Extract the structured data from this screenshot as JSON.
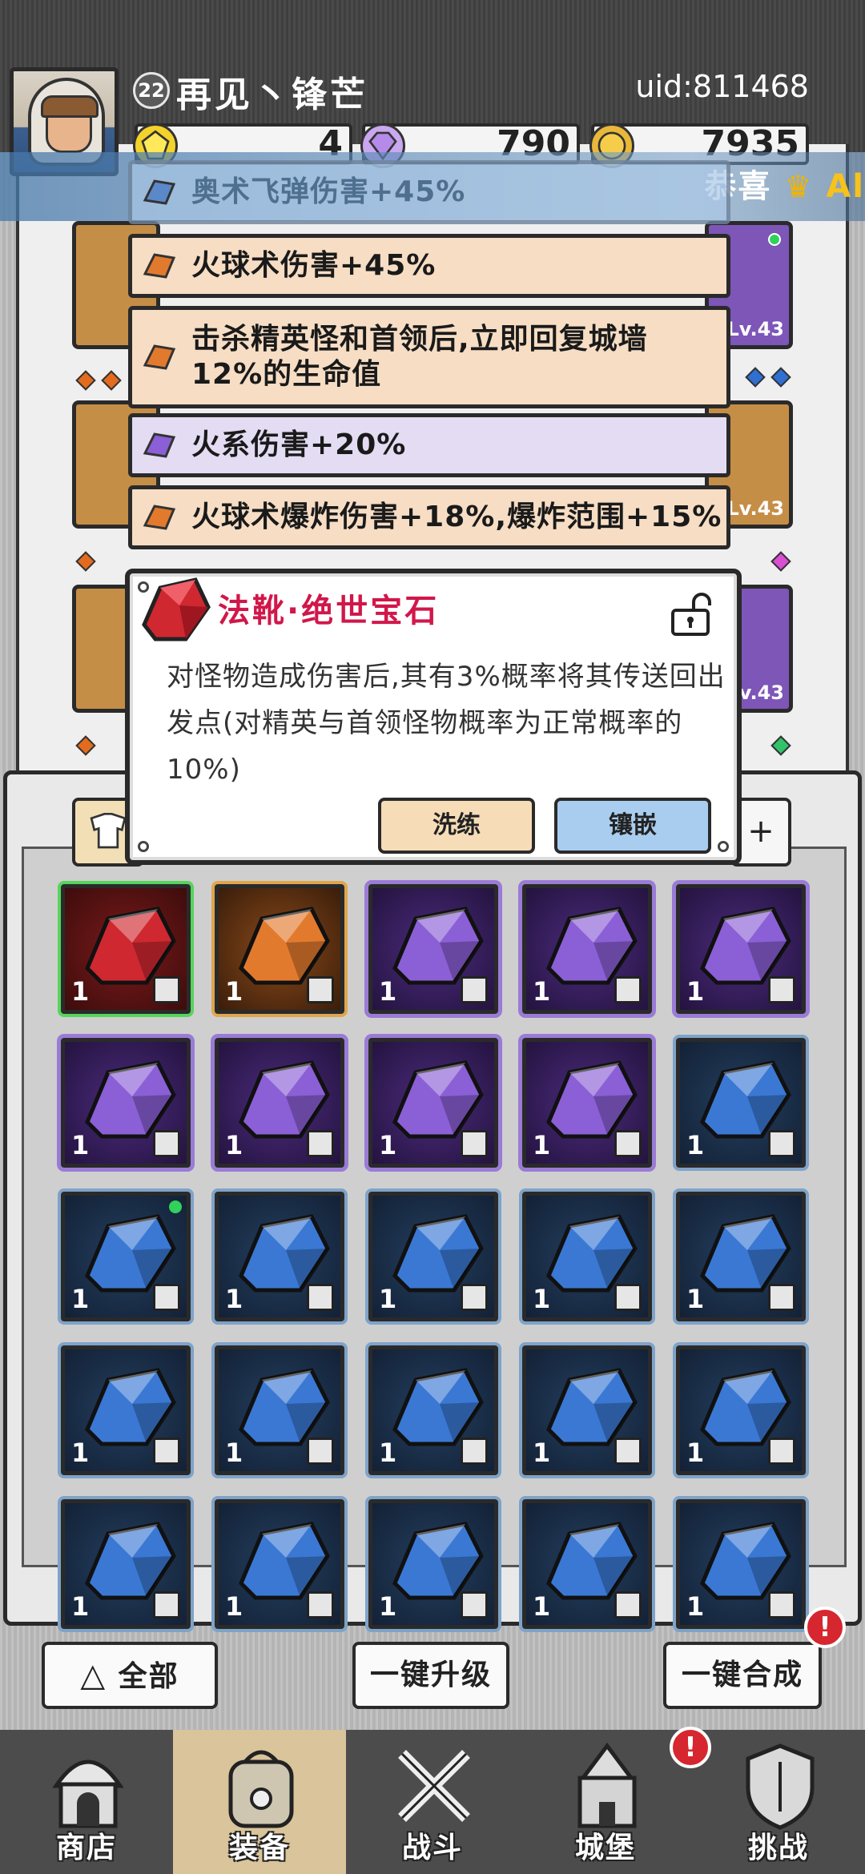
{
  "player": {
    "level": "22",
    "name": "再见丶锋芒",
    "uid": "uid:811468"
  },
  "resources": {
    "gold_gems": "4",
    "purple_gems": "790",
    "coins": "7935"
  },
  "announcement": {
    "prefix": "恭喜",
    "suffix": "Al"
  },
  "equipment_levels": [
    "Lv.43",
    "Lv.43",
    "Lv.43"
  ],
  "attributes": [
    {
      "text": "奥术飞弹伤害+45%",
      "color": "blue"
    },
    {
      "text": "火球术伤害+45%",
      "color": "orange"
    },
    {
      "text": "击杀精英怪和首领后,立即回复城墙12%的生命值",
      "color": "orange"
    },
    {
      "text": "火系伤害+20%",
      "color": "purple"
    },
    {
      "text": "火球术爆炸伤害+18%,爆炸范围+15%",
      "color": "orange"
    }
  ],
  "popup": {
    "title": "法靴·绝世宝石",
    "description": "对怪物造成伤害后,其有3%概率将其传送回出发点(对精英与首领怪物概率为正常概率的10%)",
    "reforge_label": "洗练",
    "inlay_label": "镶嵌"
  },
  "filter_right": "+",
  "inventory": [
    {
      "color": "red",
      "count": "1",
      "slot": "boots-icon"
    },
    {
      "color": "orange",
      "count": "1",
      "slot": "ring-icon"
    },
    {
      "color": "purple",
      "count": "1",
      "slot": "necklace-icon"
    },
    {
      "color": "purple",
      "count": "1",
      "slot": "necklace-icon"
    },
    {
      "color": "purple",
      "count": "1",
      "slot": "armor-icon"
    },
    {
      "color": "purple",
      "count": "1",
      "slot": "armor-icon"
    },
    {
      "color": "purple",
      "count": "1",
      "slot": "boots-icon"
    },
    {
      "color": "purple",
      "count": "1",
      "slot": "ring-icon"
    },
    {
      "color": "purple",
      "count": "1",
      "slot": "ring-icon"
    },
    {
      "color": "blue",
      "count": "1",
      "slot": "necklace-icon"
    },
    {
      "color": "blue",
      "count": "1",
      "slot": "necklace-icon",
      "new": true
    },
    {
      "color": "blue",
      "count": "1",
      "slot": "necklace-icon"
    },
    {
      "color": "blue",
      "count": "1",
      "slot": "necklace-icon"
    },
    {
      "color": "blue",
      "count": "1",
      "slot": "armor-icon"
    },
    {
      "color": "blue",
      "count": "1",
      "slot": "armor-icon"
    },
    {
      "color": "blue",
      "count": "1",
      "slot": "armor-icon"
    },
    {
      "color": "blue",
      "count": "1",
      "slot": "armor-icon"
    },
    {
      "color": "blue",
      "count": "1",
      "slot": "boots-icon"
    },
    {
      "color": "blue",
      "count": "1",
      "slot": "boots-icon"
    },
    {
      "color": "blue",
      "count": "1",
      "slot": "boots-icon"
    },
    {
      "color": "blue",
      "count": "1",
      "slot": "boots-icon"
    },
    {
      "color": "blue",
      "count": "1",
      "slot": "boots-icon"
    },
    {
      "color": "blue",
      "count": "1",
      "slot": "boots-icon"
    },
    {
      "color": "blue",
      "count": "1",
      "slot": "boots-icon"
    },
    {
      "color": "blue",
      "count": "1",
      "slot": "boots-icon"
    }
  ],
  "actions": {
    "filter_all": "全部",
    "upgrade_all": "一键升级",
    "combine_all": "一键合成",
    "alert": "!"
  },
  "nav": [
    {
      "label": "商店",
      "icon": "shop-icon",
      "active": false
    },
    {
      "label": "装备",
      "icon": "backpack-icon",
      "active": true
    },
    {
      "label": "战斗",
      "icon": "crossed-swords-icon",
      "active": false
    },
    {
      "label": "城堡",
      "icon": "castle-icon",
      "active": false
    },
    {
      "label": "挑战",
      "icon": "shield-icon",
      "active": false
    }
  ],
  "colors": {
    "red_gem": "#d02830",
    "orange_gem": "#e27a2e",
    "purple_gem": "#8b5fd6",
    "blue_gem": "#3a78d4",
    "title_red": "#d1174a",
    "inlay_blue": "#a9cdee",
    "reforge_peach": "#f7dcb8"
  }
}
